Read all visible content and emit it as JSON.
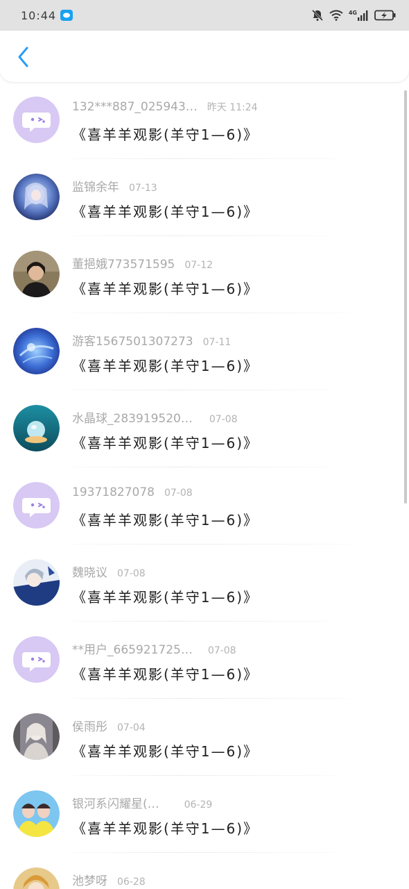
{
  "status_bar": {
    "time": "10:44",
    "network": "4G"
  },
  "header": {
    "back_icon": "chevron-left-icon",
    "accent_color": "#2a9df4"
  },
  "items": [
    {
      "name": "132***887_025943…",
      "date": "昨天 11:24",
      "title": "《喜羊羊观影(羊守1—6)》",
      "avatar": "default-chat-avatar"
    },
    {
      "name": "监锦余年",
      "date": "07-13",
      "title": "《喜羊羊观影(羊守1—6)》",
      "avatar": "user-photo"
    },
    {
      "name": "董挹娥773571595",
      "date": "07-12",
      "title": "《喜羊羊观影(羊守1—6)》",
      "avatar": "user-photo"
    },
    {
      "name": "游客1567501307273",
      "date": "07-11",
      "title": "《喜羊羊观影(羊守1—6)》",
      "avatar": "user-photo"
    },
    {
      "name": "水晶球_283919520…",
      "date": "07-08",
      "title": "《喜羊羊观影(羊守1—6)》",
      "avatar": "user-photo"
    },
    {
      "name": "19371827078",
      "date": "07-08",
      "title": "《喜羊羊观影(羊守1—6)》",
      "avatar": "default-chat-avatar"
    },
    {
      "name": "魏晓议",
      "date": "07-08",
      "title": "《喜羊羊观影(羊守1—6)》",
      "avatar": "user-photo"
    },
    {
      "name": "**用户_665921725…",
      "date": "07-08",
      "title": "《喜羊羊观影(羊守1—6)》",
      "avatar": "default-chat-avatar"
    },
    {
      "name": "侯雨彤",
      "date": "07-04",
      "title": "《喜羊羊观影(羊守1—6)》",
      "avatar": "user-photo"
    },
    {
      "name": "银河系闪耀星(…",
      "date": "06-29",
      "title": "《喜羊羊观影(羊守1—6)》",
      "avatar": "user-photo"
    },
    {
      "name": "池梦呀",
      "date": "06-28",
      "title": "",
      "avatar": "user-photo"
    }
  ]
}
